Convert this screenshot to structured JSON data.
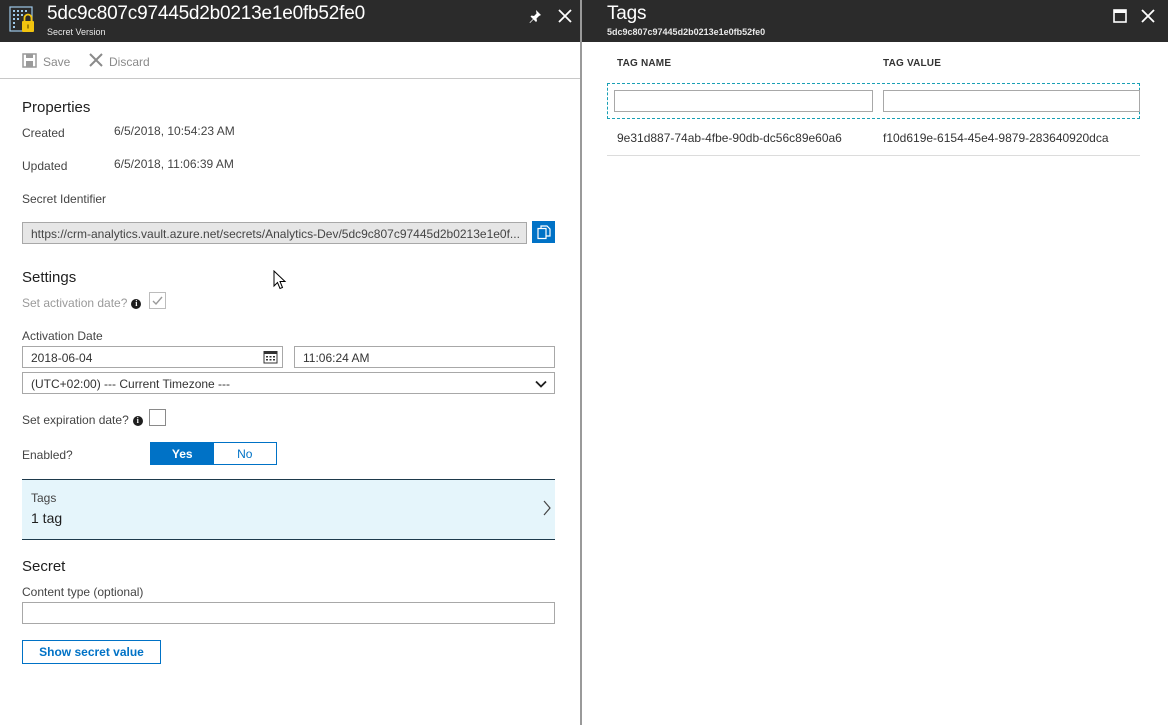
{
  "left_blade": {
    "title": "5dc9c807c97445d2b0213e1e0fb52fe0",
    "subtitle": "Secret Version",
    "toolbar": {
      "save_label": "Save",
      "discard_label": "Discard"
    },
    "properties": {
      "heading": "Properties",
      "created_label": "Created",
      "created_value": "6/5/2018, 10:54:23 AM",
      "updated_label": "Updated",
      "updated_value": "6/5/2018, 11:06:39 AM",
      "identifier_label": "Secret Identifier",
      "identifier_value": "https://crm-analytics.vault.azure.net/secrets/Analytics-Dev/5dc9c807c97445d2b0213e1e0f..."
    },
    "settings": {
      "heading": "Settings",
      "activation_check_label": "Set activation date?",
      "activation_date_label": "Activation Date",
      "activation_date_value": "2018-06-04",
      "activation_time_value": "11:06:24 AM",
      "timezone_value": "(UTC+02:00) --- Current Timezone ---",
      "expiration_check_label": "Set expiration date?",
      "enabled_label": "Enabled?",
      "enabled_yes": "Yes",
      "enabled_no": "No"
    },
    "tags_row": {
      "title": "Tags",
      "summary": "1 tag"
    },
    "secret": {
      "heading": "Secret",
      "content_type_label": "Content type (optional)",
      "content_type_value": "",
      "show_button": "Show secret value"
    }
  },
  "right_blade": {
    "title": "Tags",
    "subtitle": "5dc9c807c97445d2b0213e1e0fb52fe0",
    "columns": {
      "name": "TAG NAME",
      "value": "TAG VALUE"
    },
    "filter_name": "",
    "filter_value": "",
    "rows": [
      {
        "name": "9e31d887-74ab-4fbe-90db-dc56c89e60a6",
        "value": "f10d619e-6154-45e4-9879-283640920dca"
      }
    ]
  },
  "colors": {
    "accent": "#0072c6",
    "header_bg": "#2b2b2b",
    "tags_row_bg": "#e5f5fb",
    "filter_border": "#19a0b5"
  },
  "icons": [
    "key-vault-secret-icon",
    "pin-icon",
    "close-icon",
    "save-icon",
    "discard-icon",
    "copy-icon",
    "info-icon",
    "checkmark-icon",
    "calendar-icon",
    "chevron-down-icon",
    "chevron-right-icon",
    "maximize-icon",
    "mouse-cursor-icon"
  ]
}
